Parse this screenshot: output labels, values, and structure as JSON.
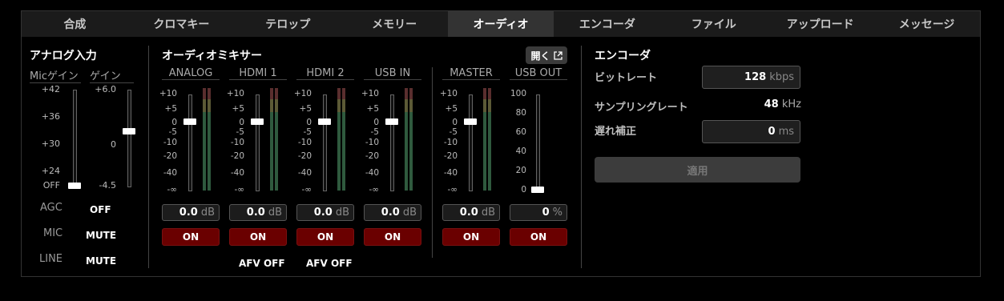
{
  "tabs": [
    {
      "label": "合成",
      "active": false
    },
    {
      "label": "クロマキー",
      "active": false
    },
    {
      "label": "テロップ",
      "active": false
    },
    {
      "label": "メモリー",
      "active": false
    },
    {
      "label": "オーディオ",
      "active": true
    },
    {
      "label": "エンコーダ",
      "active": false
    },
    {
      "label": "ファイル",
      "active": false
    },
    {
      "label": "アップロード",
      "active": false
    },
    {
      "label": "メッセージ",
      "active": false
    }
  ],
  "analog": {
    "title": "アナログ入力",
    "mic_gain_label": "Micゲイン",
    "gain_label": "ゲイン",
    "mic_ticks": [
      "+42",
      "+36",
      "+30",
      "+24",
      "OFF"
    ],
    "gain_ticks": [
      "+6.0",
      "0",
      "-4.5"
    ],
    "mic_gain_level": 0.0,
    "gain_level": 0.57,
    "rows": [
      {
        "label": "AGC",
        "value": "OFF"
      },
      {
        "label": "MIC",
        "value": "MUTE"
      },
      {
        "label": "LINE",
        "value": "MUTE"
      }
    ]
  },
  "mixer": {
    "title": "オーディオミキサー",
    "open_label": "開く",
    "channels": [
      {
        "name": "ANALOG",
        "value": "0.0",
        "unit": "dB",
        "button": "ON",
        "afv": ""
      },
      {
        "name": "HDMI 1",
        "value": "0.0",
        "unit": "dB",
        "button": "ON",
        "afv": "AFV OFF"
      },
      {
        "name": "HDMI 2",
        "value": "0.0",
        "unit": "dB",
        "button": "ON",
        "afv": "AFV OFF"
      },
      {
        "name": "USB IN",
        "value": "0.0",
        "unit": "dB",
        "button": "ON",
        "afv": ""
      }
    ],
    "master": {
      "name": "MASTER",
      "value": "0.0",
      "unit": "dB",
      "button": "ON"
    },
    "usbout": {
      "name": "USB OUT",
      "value": "0",
      "unit": "%",
      "button": "ON",
      "ticks": [
        "100",
        "80",
        "60",
        "40",
        "20",
        "0"
      ],
      "level": 0.0
    },
    "db_ticks": [
      "+10",
      "+5",
      "0",
      "-5",
      "-10",
      "-20",
      "-40",
      "-∞"
    ]
  },
  "encoder": {
    "title": "エンコーダ",
    "bitrate_label": "ビットレート",
    "bitrate_value": "128",
    "bitrate_unit": "kbps",
    "sampling_label": "サンプリングレート",
    "sampling_value": "48",
    "sampling_unit": "kHz",
    "delay_label": "遅れ補正",
    "delay_value": "0",
    "delay_unit": "ms",
    "apply_label": "適用"
  }
}
